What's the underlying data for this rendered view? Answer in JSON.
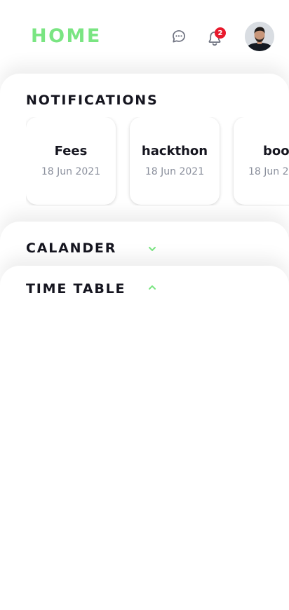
{
  "header": {
    "title": "HOME",
    "chat_icon": "chat-bubble-icon",
    "bell_icon": "bell-icon",
    "notification_count": "2",
    "avatar_alt": "user avatar"
  },
  "notifications": {
    "title": "NOTIFICATIONS",
    "items": [
      {
        "title": "Fees",
        "date": "18 Jun 2021"
      },
      {
        "title": "hackthon",
        "date": "18 Jun 2021"
      },
      {
        "title": "boo",
        "date": "18 Jun 2"
      }
    ]
  },
  "calander": {
    "title": "CALANDER",
    "icon": "chevron-down-icon"
  },
  "time_table": {
    "title": "TIME TABLE",
    "icon": "chevron-up-icon"
  },
  "colors": {
    "accent": "#7ae582",
    "badge": "#e8192c",
    "text": "#15151f",
    "muted": "#8a8f9c"
  }
}
